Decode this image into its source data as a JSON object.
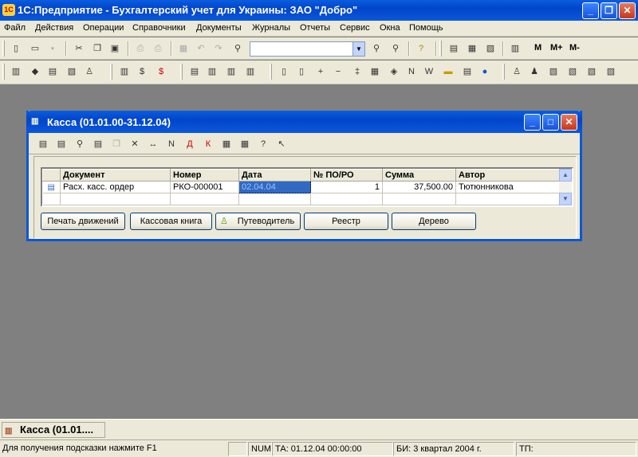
{
  "app": {
    "title": "1С:Предприятие - Бухгалтерский учет для Украины: ЗАО \"Добро\"",
    "logo": "1С"
  },
  "menu": [
    "Файл",
    "Действия",
    "Операции",
    "Справочники",
    "Документы",
    "Журналы",
    "Отчеты",
    "Сервис",
    "Окна",
    "Помощь"
  ],
  "toolbar": {
    "combo_value": "",
    "m_buttons": [
      "M",
      "M+",
      "M-"
    ]
  },
  "window": {
    "title": "Касса (01.01.00-31.12.04)",
    "columns": [
      "Документ",
      "Номер",
      "Дата",
      "№ ПО/РО",
      "Сумма",
      "Автор"
    ],
    "rows": [
      {
        "doc": "Расх. касс. ордер",
        "number": "РКО-000001",
        "date": "02.04.04",
        "po": "1",
        "sum": "37,500.00",
        "author": "Тютюнникова"
      }
    ],
    "buttons": {
      "print": "Печать движений",
      "cashbook": "Кассовая книга",
      "guide": "Путеводитель",
      "register": "Реестр",
      "tree": "Дерево"
    }
  },
  "taskbar": {
    "item": "Касса (01.01...."
  },
  "status": {
    "hint": "Для получения подсказки нажмите F1",
    "num": "NUM",
    "ta": "ТА: 01.12.04  00:00:00",
    "bi": "БИ: 3 квартал 2004 г.",
    "tp": "ТП:"
  }
}
